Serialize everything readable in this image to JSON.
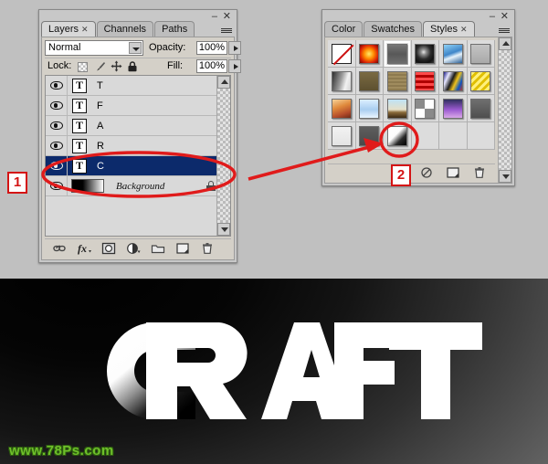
{
  "app": {
    "background_color": "#c0c0c0"
  },
  "layers_panel": {
    "title": "Layers",
    "tabs": [
      {
        "label": "Layers",
        "active": true,
        "closable": true
      },
      {
        "label": "Channels",
        "active": false,
        "closable": false
      },
      {
        "label": "Paths",
        "active": false,
        "closable": false
      }
    ],
    "blend_mode": "Normal",
    "opacity_label": "Opacity:",
    "opacity_value": "100%",
    "lock_label": "Lock:",
    "lock_icons": [
      "transparent-pixels-icon",
      "brush-icon",
      "move-icon",
      "lock-all-icon"
    ],
    "fill_label": "Fill:",
    "fill_value": "100%",
    "layers": [
      {
        "name": "T",
        "type": "text",
        "visible": true,
        "selected": false
      },
      {
        "name": "F",
        "type": "text",
        "visible": true,
        "selected": false
      },
      {
        "name": "A",
        "type": "text",
        "visible": true,
        "selected": false
      },
      {
        "name": "R",
        "type": "text",
        "visible": true,
        "selected": false
      },
      {
        "name": "C",
        "type": "text",
        "visible": true,
        "selected": true
      },
      {
        "name": "Background",
        "type": "background",
        "visible": true,
        "selected": false,
        "locked": true
      }
    ],
    "selection_color": "#0c2a6b",
    "bottom_icons": [
      "link-layers-icon",
      "add-layer-style-icon",
      "add-layer-mask-icon",
      "new-fill-adjustment-icon",
      "new-group-icon",
      "new-layer-icon",
      "delete-layer-icon"
    ],
    "window_buttons": [
      "minimize-icon",
      "close-icon"
    ]
  },
  "styles_panel": {
    "title": "Styles",
    "tabs": [
      {
        "label": "Color",
        "active": false,
        "closable": false
      },
      {
        "label": "Swatches",
        "active": false,
        "closable": false
      },
      {
        "label": "Styles",
        "active": true,
        "closable": true
      }
    ],
    "swatches": [
      [
        {
          "name": "default-none",
          "style": "none"
        },
        {
          "name": "red-glow",
          "css": "radial-gradient(circle at 50% 50%, #ffe96a 0%, #ff8a00 38%, #d81f06 72%, #6b0b02 100%)"
        },
        {
          "name": "gray-button",
          "css": "linear-gradient(180deg,#777 0%,#585858 50%,#6d6d6d 100%)",
          "selected": true
        },
        {
          "name": "dark-swirl",
          "css": "radial-gradient(circle at 44% 40%, #e8e8e8 0%, #8d8d8d 18%, #2b2b2b 48%, #111 75%, #3a3a3a 100%)"
        },
        {
          "name": "blue-sky",
          "css": "linear-gradient(160deg,#8fd2f7 0%,#3f86c9 45%,#e7f3fb 62%,#2a5f96 100%)"
        },
        {
          "name": "light-gray",
          "css": "linear-gradient(180deg,#c4c4c4 0%,#a9a9a9 100%)"
        }
      ],
      [
        {
          "name": "silver-fade",
          "css": "linear-gradient(105deg,#2e2e2e 0%,#9a9a9a 45%,#f2f2f2 72%,#d2d2d2 100%)"
        },
        {
          "name": "olive-brown",
          "css": "linear-gradient(180deg,#7a6a42 0%,#5d5030 100%)"
        },
        {
          "name": "tan-texture",
          "css": "repeating-linear-gradient(180deg,#a08c5e 0 2px,#8d7a4f 2px 4px)"
        },
        {
          "name": "red-stripes",
          "css": "repeating-linear-gradient(180deg,#ff4a4a 0 3px,#b00000 3px 6px)"
        },
        {
          "name": "colorful-paint",
          "css": "linear-gradient(115deg,#1c1c86 0%,#e7e7ff 22%,#1b1b1b 44%,#f0c21a 62%,#0b55c2 82%,#c0392b 100%)"
        },
        {
          "name": "yellow-foil",
          "css": "repeating-linear-gradient(135deg,#fff07a 0 3px,#e0bf00 3px 6px)"
        }
      ],
      [
        {
          "name": "sunset-gradient",
          "css": "linear-gradient(160deg,#f6d39a 0%,#e08a3c 40%,#b24a2a 75%,#6d2a18 100%)"
        },
        {
          "name": "pale-blue",
          "css": "linear-gradient(180deg,#dceeff 0%,#a9cdf0 55%,#eaf5ff 100%)"
        },
        {
          "name": "landscape",
          "css": "linear-gradient(180deg,#bfe2f5 0%,#e6e0c8 55%,#8a6a3a 70%,#3b2a14 100%)"
        },
        {
          "name": "noise-texture",
          "css": "repeating-conic-gradient(#fff 0 25%, #8a8a8a 0 50%)"
        },
        {
          "name": "purple-gradient",
          "css": "linear-gradient(180deg,#2f2f5e 0%,#9b5ad0 55%,#d9a8e8 100%)"
        },
        {
          "name": "flat-gray",
          "css": "linear-gradient(180deg,#6f6f6f 0%,#4f4f4f 100%)"
        }
      ],
      [
        {
          "name": "white-swatch",
          "css": "linear-gradient(180deg,#f2f2f2 0%,#e4e4e4 100%)"
        },
        {
          "name": "medium-gray",
          "css": "linear-gradient(180deg,#5e5e5e 0%,#4a4a4a 100%)"
        },
        {
          "name": "white-black-gradient",
          "css": "linear-gradient(135deg,#ffffff 0%,#fdfdfd 42%,#2a2a2a 70%,#000000 100%)",
          "highlighted": true
        }
      ]
    ],
    "bottom_icons": [
      "clear-style-icon",
      "new-style-icon",
      "delete-style-icon"
    ],
    "window_buttons": [
      "minimize-icon",
      "close-icon"
    ]
  },
  "annotations": {
    "marker_1": "1",
    "marker_2": "2",
    "color": "#d41414",
    "ellipse_layers": "highlight around selected C layer row",
    "ellipse_styles": "highlight around white-black-gradient style swatch",
    "arrow": "points from layers selection to styles swatch"
  },
  "canvas": {
    "text": "CRAFT",
    "watermark": "www.78Ps.com",
    "watermark_color": "#6ec02a",
    "background": "dark radial gradient black to gray"
  }
}
